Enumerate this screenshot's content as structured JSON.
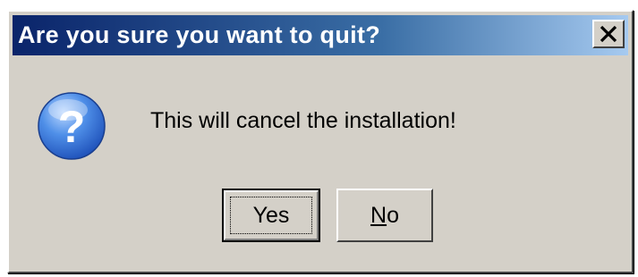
{
  "dialog": {
    "title": "Are you sure you want to quit?",
    "close_symbol": "✕",
    "icon": "question-icon",
    "message": "This will cancel the installation!",
    "buttons": {
      "yes_label": "Yes",
      "no_mnemonic": "N",
      "no_rest": "o"
    }
  },
  "colors": {
    "titlebar_start": "#0a246a",
    "titlebar_end": "#a6caf0",
    "dialog_face": "#d4d0c8",
    "icon_blue": "#2f6fd6"
  }
}
